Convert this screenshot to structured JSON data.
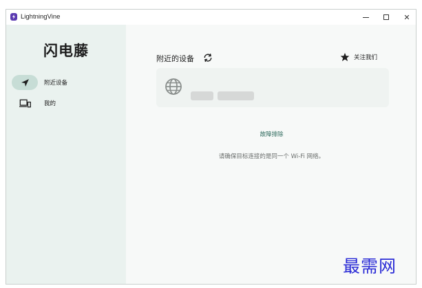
{
  "window": {
    "app_title": "LightningVine",
    "controls": {
      "minimize": "minimize",
      "maximize": "maximize",
      "close": "✕"
    }
  },
  "sidebar": {
    "brand": "闪电藤",
    "items": [
      {
        "label": "附近设备",
        "icon": "send-arrow-icon",
        "selected": true
      },
      {
        "label": "我的",
        "icon": "devices-icon",
        "selected": false
      }
    ]
  },
  "main": {
    "section_title": "附近的设备",
    "follow_label": "关注我们",
    "troubleshoot_link": "故障排除",
    "hint": "请确保目标连接的是同一个 Wi-Fi 网络。"
  },
  "watermark": "最需网",
  "colors": {
    "sidebar_bg": "#eaf2ef",
    "selected_pill": "#c7ddd6",
    "link": "#2f6b5e",
    "watermark": "#2a2bd6"
  }
}
